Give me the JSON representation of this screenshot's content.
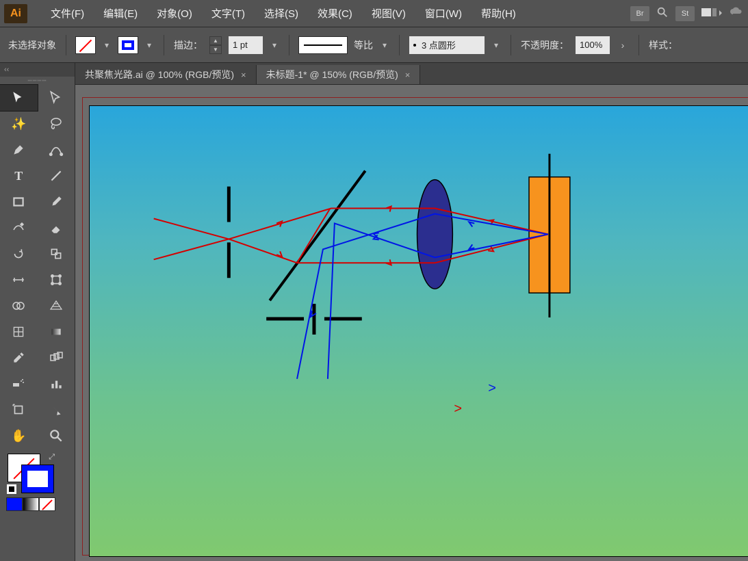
{
  "app": {
    "logo": "Ai"
  },
  "menu": {
    "file": "文件(F)",
    "edit": "编辑(E)",
    "object": "对象(O)",
    "text": "文字(T)",
    "select": "选择(S)",
    "effect": "效果(C)",
    "view": "视图(V)",
    "window": "窗口(W)",
    "help": "帮助(H)"
  },
  "menubar_right": {
    "bridge": "Br",
    "stock": "St"
  },
  "control": {
    "selection_status": "未选择对象",
    "stroke_label": "描边：",
    "stroke_weight": "1 pt",
    "profile_label": "等比",
    "brush_label": "3 点圆形",
    "opacity_label": "不透明度：",
    "opacity_value": "100%",
    "style_label": "样式："
  },
  "tabs": [
    {
      "label": "共聚焦光路.ai @ 100% (RGB/预览)"
    },
    {
      "label": "未标题-1* @ 150% (RGB/预览)"
    }
  ],
  "colors": {
    "stroke": "#0011ff",
    "accent": "#f7931e"
  },
  "tool_names": {
    "selection": "selection-tool",
    "direct_selection": "direct-selection-tool",
    "wand": "magic-wand-tool",
    "lasso": "lasso-tool",
    "pen": "pen-tool",
    "curvature": "curvature-tool",
    "type": "type-tool",
    "line": "line-segment-tool",
    "rect": "rectangle-tool",
    "brush": "paintbrush-tool",
    "pencil": "pencil-tool",
    "eraser": "eraser-tool",
    "rotate": "rotate-tool",
    "scale": "scale-tool",
    "width": "width-tool",
    "freetrans": "free-transform-tool",
    "puppet": "shape-builder-tool",
    "perspective": "perspective-grid-tool",
    "mesh": "mesh-tool",
    "gradient": "gradient-tool",
    "eyedropper": "eyedropper-tool",
    "blend": "blend-tool",
    "symbol": "symbol-sprayer-tool",
    "graph": "column-graph-tool",
    "artboard": "artboard-tool",
    "slice": "slice-tool",
    "hand": "hand-tool",
    "zoom": "zoom-tool"
  }
}
